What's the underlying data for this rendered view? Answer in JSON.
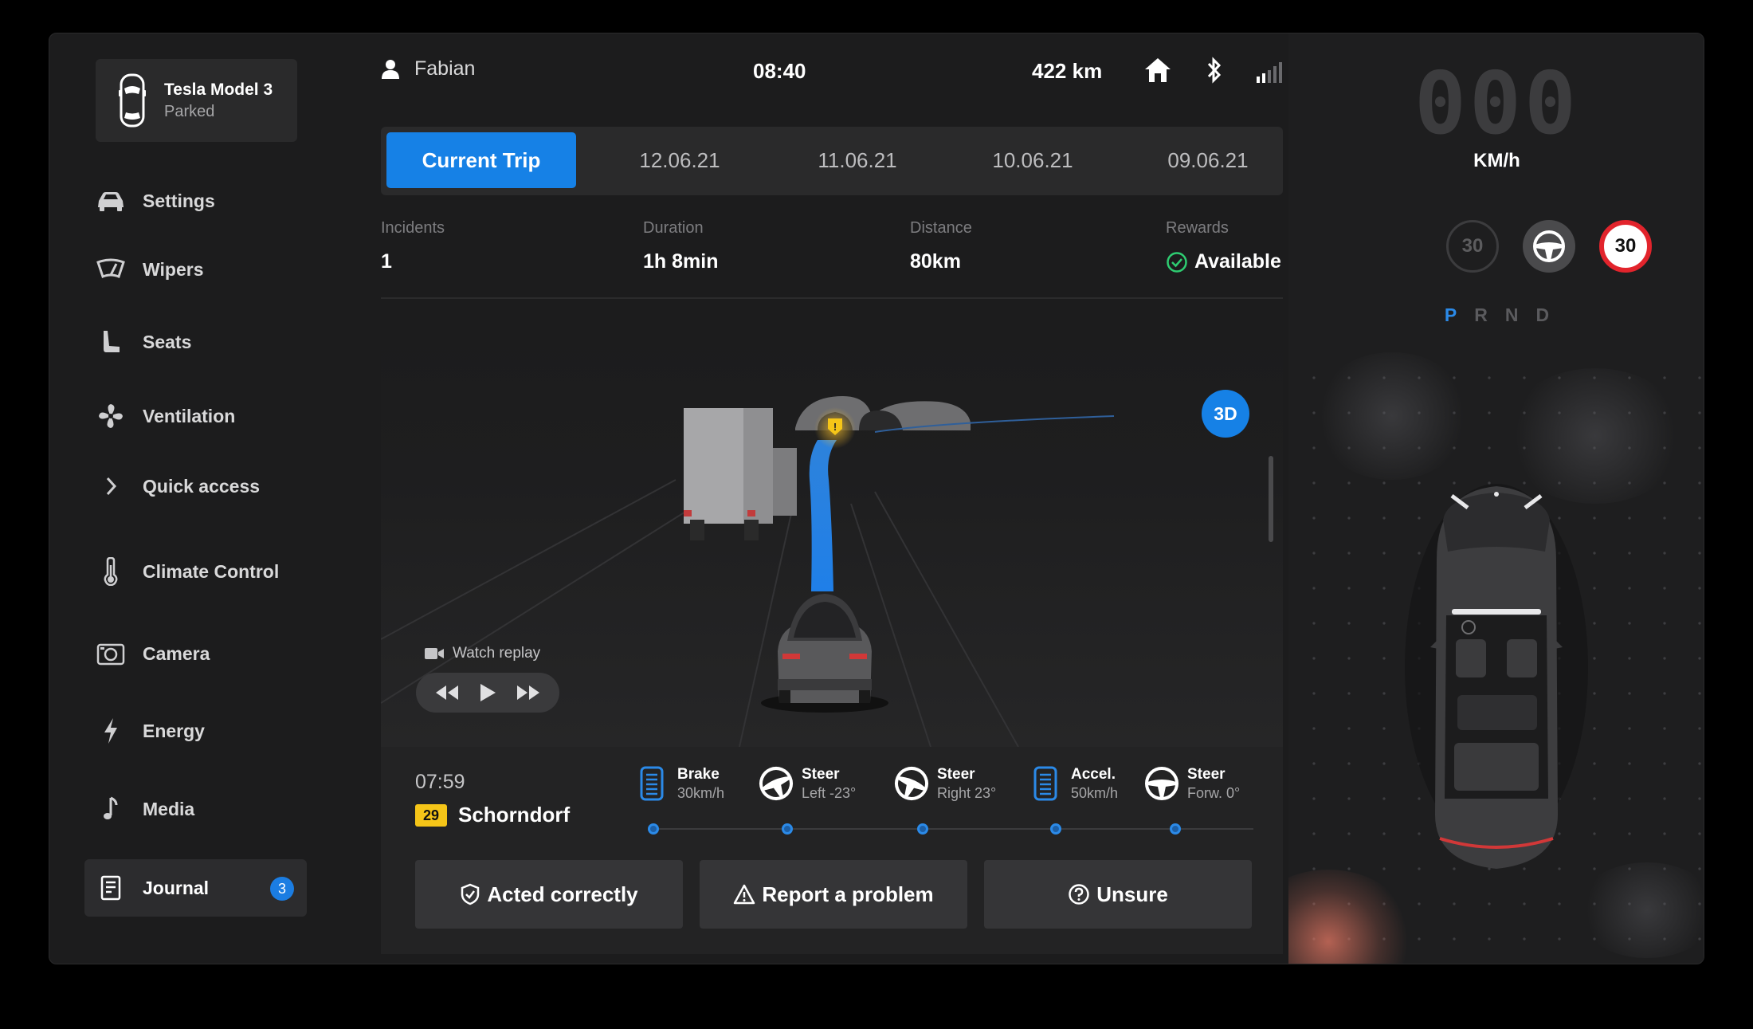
{
  "vehicle": {
    "name": "Tesla Model 3",
    "status": "Parked"
  },
  "sidebar": {
    "items": [
      {
        "label": "Settings",
        "icon": "car-front-icon"
      },
      {
        "label": "Wipers",
        "icon": "wiper-icon"
      },
      {
        "label": "Seats",
        "icon": "seat-icon"
      },
      {
        "label": "Ventilation",
        "icon": "fan-icon"
      },
      {
        "label": "Quick access",
        "icon": "chevron-right-icon"
      },
      {
        "label": "Climate Control",
        "icon": "thermometer-icon"
      },
      {
        "label": "Camera",
        "icon": "camera-icon"
      },
      {
        "label": "Energy",
        "icon": "bolt-icon"
      },
      {
        "label": "Media",
        "icon": "music-note-icon"
      },
      {
        "label": "Journal",
        "icon": "journal-icon",
        "badge": "3",
        "active": true
      }
    ]
  },
  "status_bar": {
    "user": "Fabian",
    "time": "08:40",
    "range": "422 km"
  },
  "trip_tabs": [
    "Current Trip",
    "12.06.21",
    "11.06.21",
    "10.06.21",
    "09.06.21"
  ],
  "stats": [
    {
      "label": "Incidents",
      "value": "1"
    },
    {
      "label": "Duration",
      "value": "1h 8min"
    },
    {
      "label": "Distance",
      "value": "80km"
    },
    {
      "label": "Rewards",
      "value": "Available"
    }
  ],
  "scene": {
    "view_toggle": "3D",
    "replay_label": "Watch replay"
  },
  "incident": {
    "time": "07:59",
    "road_number": "29",
    "location": "Schorndorf",
    "events": [
      {
        "name": "Brake",
        "value": "30km/h",
        "icon": "brake-pedal-icon"
      },
      {
        "name": "Steer",
        "value": "Left -23°",
        "icon": "steering-left-icon"
      },
      {
        "name": "Steer",
        "value": "Right 23°",
        "icon": "steering-right-icon"
      },
      {
        "name": "Accel.",
        "value": "50km/h",
        "icon": "accel-pedal-icon"
      },
      {
        "name": "Steer",
        "value": "Forw. 0°",
        "icon": "steering-forward-icon"
      }
    ],
    "actions": {
      "correct": "Acted correctly",
      "report": "Report a problem",
      "unsure": "Unsure"
    }
  },
  "right_panel": {
    "speed": "000",
    "speed_unit": "KM/h",
    "set_limit": "30",
    "road_limit": "30",
    "gears": [
      "P",
      "R",
      "N",
      "D"
    ],
    "active_gear": "P"
  },
  "colors": {
    "accent": "#1681e6",
    "limit_red": "#e2242c",
    "road_sign_yellow": "#f5c518"
  }
}
